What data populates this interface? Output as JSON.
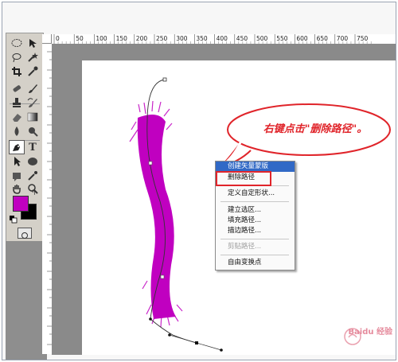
{
  "ruler": {
    "ticks": [
      "0",
      "50",
      "100",
      "150",
      "200",
      "250",
      "300",
      "350",
      "400",
      "450",
      "500",
      "550",
      "600",
      "650",
      "700",
      "750"
    ]
  },
  "colors": {
    "foreground": "#c000c0",
    "background": "#000000",
    "brush": "#c000c0",
    "menu_highlight": "#3169c6",
    "annotation_red": "#e0242a"
  },
  "context_menu": {
    "items": [
      {
        "label": "创建矢量蒙版",
        "state": "highlighted"
      },
      {
        "label": "删除路径",
        "state": "normal"
      },
      {
        "label": "定义自定形状...",
        "state": "normal"
      },
      {
        "label": "建立选区...",
        "state": "normal"
      },
      {
        "label": "填充路径...",
        "state": "normal"
      },
      {
        "label": "描边路径...",
        "state": "normal"
      },
      {
        "label": "剪贴路径...",
        "state": "disabled"
      },
      {
        "label": "自由变换点",
        "state": "normal"
      }
    ]
  },
  "annotation": {
    "text": "右键点击\"删除路径\"。"
  },
  "watermark": {
    "text": "Baidu 经验"
  },
  "tools": [
    "marquee-icon",
    "move-icon",
    "lasso-icon",
    "magic-wand-icon",
    "crop-icon",
    "eyedropper-icon",
    "healing-brush-icon",
    "brush-icon",
    "clone-stamp-icon",
    "history-brush-icon",
    "eraser-icon",
    "gradient-icon",
    "blur-icon",
    "dodge-icon",
    "pen-icon",
    "type-icon",
    "path-selection-icon",
    "shape-icon",
    "notes-icon",
    "eyedropper2-icon",
    "hand-icon",
    "zoom-icon"
  ]
}
